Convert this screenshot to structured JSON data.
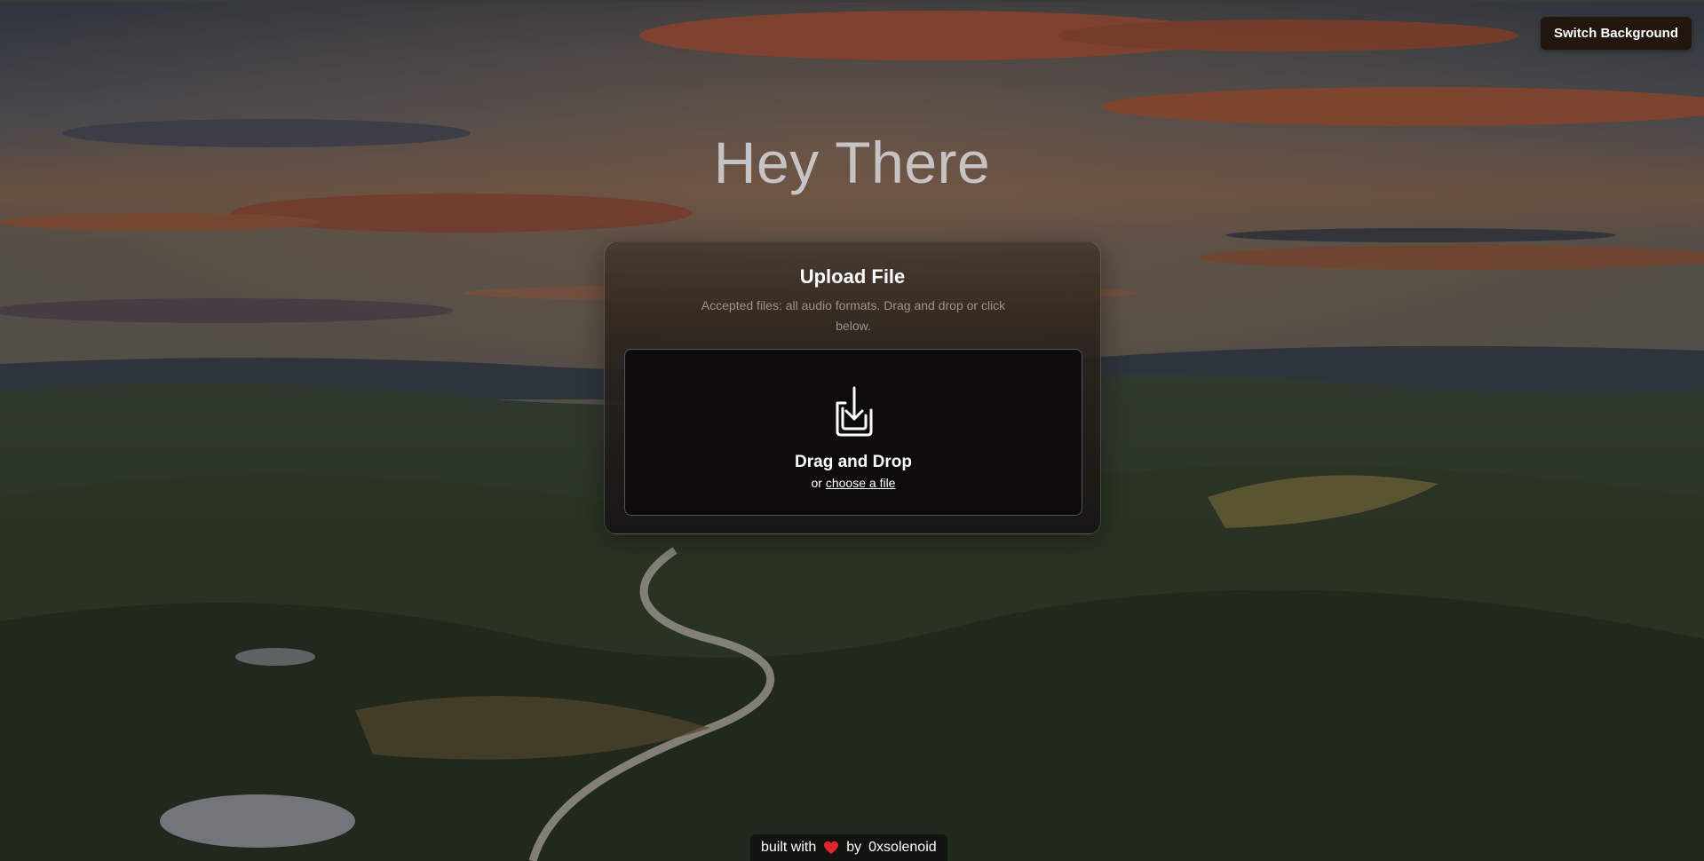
{
  "header": {
    "switch_background_label": "Switch Background"
  },
  "hero": {
    "title": "Hey There"
  },
  "upload": {
    "title": "Upload File",
    "subtitle": "Accepted files: all audio formats. Drag and drop or click below.",
    "dropzone_title": "Drag and Drop",
    "dropzone_or": "or",
    "dropzone_link": "choose a file"
  },
  "footer": {
    "built_with": "built with",
    "by": "by",
    "author": "0xsolenoid"
  },
  "icons": {
    "dropzone": "download-tray-icon",
    "footer": "heart-icon"
  },
  "colors": {
    "button_bg": "#22160f",
    "heart": "#e0242e",
    "dropzone_bg": "#0d0c0b"
  }
}
